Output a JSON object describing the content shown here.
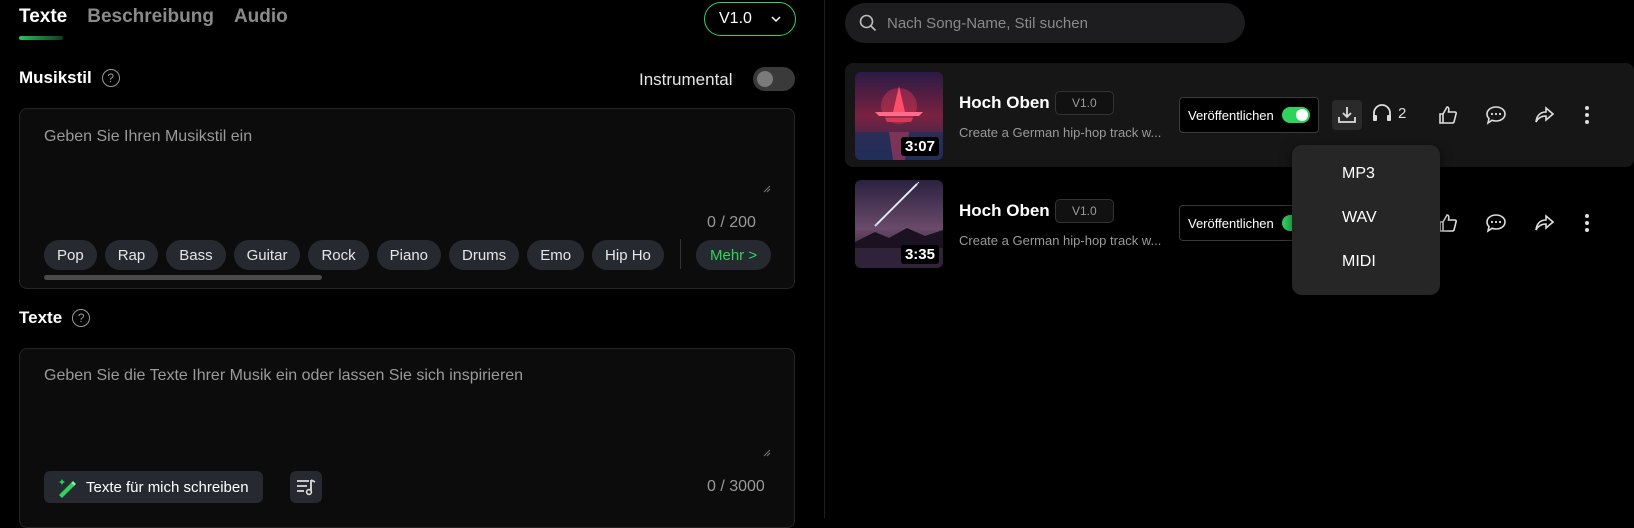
{
  "tabs": [
    "Texte",
    "Beschreibung",
    "Audio"
  ],
  "version_select": {
    "value": "V1.0"
  },
  "musikstil": {
    "label": "Musikstil",
    "help": "?",
    "instrumental_label": "Instrumental",
    "placeholder": "Geben Sie Ihren Musikstil ein",
    "count": "0 / 200",
    "chips": [
      "Pop",
      "Rap",
      "Bass",
      "Guitar",
      "Rock",
      "Piano",
      "Drums",
      "Emo",
      "Hip Ho"
    ],
    "more": "Mehr >"
  },
  "texte": {
    "label": "Texte",
    "help": "?",
    "placeholder": "Geben Sie die Texte Ihrer Musik ein oder lassen Sie sich inspirieren",
    "write_button": "Texte für mich schreiben",
    "count": "0 / 3000"
  },
  "search": {
    "placeholder": "Nach Song-Name, Stil suchen"
  },
  "songs": [
    {
      "title": "Hoch Oben",
      "version": "V1.0",
      "description": "Create a German hip-hop track w...",
      "duration": "3:07",
      "publish_label": "Veröffentlichen",
      "listens": "2"
    },
    {
      "title": "Hoch Oben",
      "version": "V1.0",
      "description": "Create a German hip-hop track w...",
      "duration": "3:35",
      "publish_label": "Veröffentlichen"
    }
  ],
  "download_menu": [
    "MP3",
    "WAV",
    "MIDI"
  ],
  "colors": {
    "accent": "#2fd35c",
    "background": "#000000",
    "panel": "#161616",
    "chip": "#262a30"
  }
}
